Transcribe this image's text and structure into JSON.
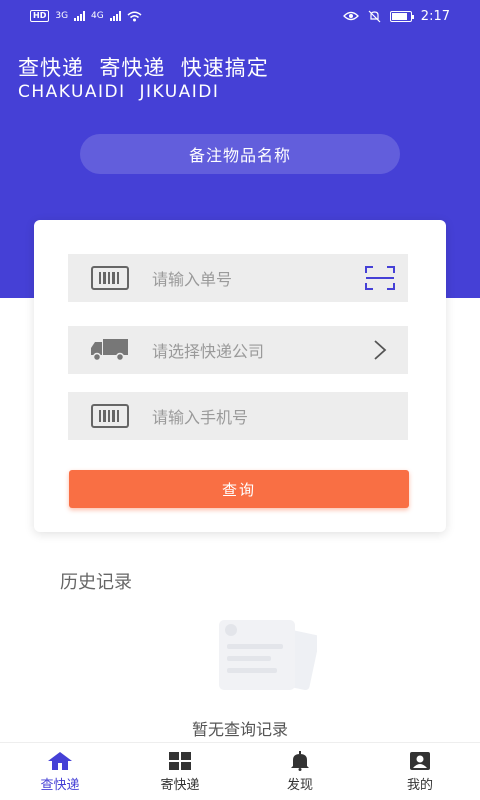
{
  "status_bar": {
    "network_left": "HD",
    "sim1": "3G",
    "sim2": "4G",
    "time": "2:17",
    "battery_level": 0.85
  },
  "hero": {
    "slogan_cn": "查快递  寄快递  快速搞定",
    "slogan_en": "CHAKUAIDI  JIKUAIDI",
    "remark_placeholder": "备注物品名称"
  },
  "form": {
    "tracking_placeholder": "请输入单号",
    "courier_placeholder": "请选择快递公司",
    "phone_placeholder": "请输入手机号",
    "submit_label": "查询"
  },
  "history": {
    "title": "历史记录",
    "empty_text": "暂无查询记录"
  },
  "tabs": [
    {
      "label": "查快递",
      "icon": "home-icon",
      "active": true
    },
    {
      "label": "寄快递",
      "icon": "grid-icon",
      "active": false
    },
    {
      "label": "发现",
      "icon": "bell-icon",
      "active": false
    },
    {
      "label": "我的",
      "icon": "profile-icon",
      "active": false
    }
  ],
  "colors": {
    "brand": "#4540d6",
    "accent": "#f96f44",
    "field_bg": "#ededed"
  }
}
